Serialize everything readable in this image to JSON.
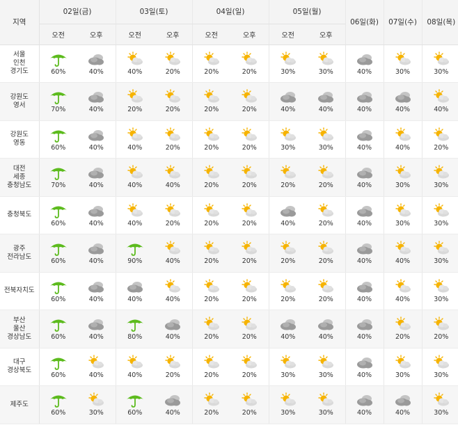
{
  "header": {
    "region_label": "지역",
    "days": [
      {
        "label": "02일(금)",
        "split": true
      },
      {
        "label": "03일(토)",
        "split": true
      },
      {
        "label": "04일(일)",
        "split": true
      },
      {
        "label": "05일(월)",
        "split": true
      },
      {
        "label": "06일(화)",
        "split": false
      },
      {
        "label": "07일(수)",
        "split": false
      },
      {
        "label": "08일(목)",
        "split": false
      }
    ],
    "am_label": "오전",
    "pm_label": "오후"
  },
  "legend_icons": {
    "rain": "umbrella-icon",
    "cloud": "cloud-icon",
    "partly": "partly-cloudy-icon"
  },
  "colors": {
    "umbrella": "#5dbb1e",
    "cloud": "#9a9a9a",
    "sun": "#f6b300"
  },
  "rows": [
    {
      "region": "서울\n인천\n경기도",
      "cells": [
        [
          "rain",
          "60%"
        ],
        [
          "cloud",
          "40%"
        ],
        [
          "partly",
          "40%"
        ],
        [
          "partly",
          "20%"
        ],
        [
          "partly",
          "20%"
        ],
        [
          "partly",
          "20%"
        ],
        [
          "partly",
          "30%"
        ],
        [
          "partly",
          "30%"
        ],
        [
          "cloud",
          "40%"
        ],
        [
          "partly",
          "30%"
        ],
        [
          "partly",
          "30%"
        ]
      ]
    },
    {
      "region": "강원도\n영서",
      "cells": [
        [
          "rain",
          "70%"
        ],
        [
          "cloud",
          "40%"
        ],
        [
          "partly",
          "20%"
        ],
        [
          "partly",
          "20%"
        ],
        [
          "partly",
          "20%"
        ],
        [
          "partly",
          "20%"
        ],
        [
          "cloud",
          "40%"
        ],
        [
          "cloud",
          "40%"
        ],
        [
          "cloud",
          "40%"
        ],
        [
          "cloud",
          "40%"
        ],
        [
          "partly",
          "40%"
        ]
      ]
    },
    {
      "region": "강원도\n영동",
      "cells": [
        [
          "rain",
          "60%"
        ],
        [
          "cloud",
          "40%"
        ],
        [
          "partly",
          "40%"
        ],
        [
          "partly",
          "20%"
        ],
        [
          "partly",
          "20%"
        ],
        [
          "partly",
          "20%"
        ],
        [
          "partly",
          "30%"
        ],
        [
          "partly",
          "30%"
        ],
        [
          "cloud",
          "40%"
        ],
        [
          "partly",
          "40%"
        ],
        [
          "partly",
          "20%"
        ]
      ]
    },
    {
      "region": "대전\n세종\n충청남도",
      "cells": [
        [
          "rain",
          "70%"
        ],
        [
          "cloud",
          "40%"
        ],
        [
          "partly",
          "40%"
        ],
        [
          "partly",
          "40%"
        ],
        [
          "partly",
          "20%"
        ],
        [
          "partly",
          "20%"
        ],
        [
          "partly",
          "20%"
        ],
        [
          "partly",
          "20%"
        ],
        [
          "cloud",
          "40%"
        ],
        [
          "partly",
          "30%"
        ],
        [
          "partly",
          "30%"
        ]
      ]
    },
    {
      "region": "충청북도",
      "cells": [
        [
          "rain",
          "60%"
        ],
        [
          "cloud",
          "40%"
        ],
        [
          "partly",
          "40%"
        ],
        [
          "partly",
          "20%"
        ],
        [
          "partly",
          "20%"
        ],
        [
          "partly",
          "20%"
        ],
        [
          "cloud",
          "40%"
        ],
        [
          "partly",
          "20%"
        ],
        [
          "cloud",
          "40%"
        ],
        [
          "partly",
          "30%"
        ],
        [
          "partly",
          "30%"
        ]
      ]
    },
    {
      "region": "광주\n전라남도",
      "cells": [
        [
          "rain",
          "60%"
        ],
        [
          "cloud",
          "40%"
        ],
        [
          "rain",
          "90%"
        ],
        [
          "partly",
          "40%"
        ],
        [
          "partly",
          "20%"
        ],
        [
          "partly",
          "20%"
        ],
        [
          "partly",
          "20%"
        ],
        [
          "partly",
          "20%"
        ],
        [
          "cloud",
          "40%"
        ],
        [
          "partly",
          "40%"
        ],
        [
          "partly",
          "30%"
        ]
      ]
    },
    {
      "region": "전북자치도",
      "cells": [
        [
          "rain",
          "60%"
        ],
        [
          "cloud",
          "40%"
        ],
        [
          "cloud",
          "40%"
        ],
        [
          "partly",
          "40%"
        ],
        [
          "partly",
          "20%"
        ],
        [
          "partly",
          "20%"
        ],
        [
          "partly",
          "20%"
        ],
        [
          "partly",
          "20%"
        ],
        [
          "cloud",
          "40%"
        ],
        [
          "partly",
          "40%"
        ],
        [
          "partly",
          "30%"
        ]
      ]
    },
    {
      "region": "부산\n울산\n경상남도",
      "cells": [
        [
          "rain",
          "60%"
        ],
        [
          "cloud",
          "40%"
        ],
        [
          "rain",
          "80%"
        ],
        [
          "cloud",
          "40%"
        ],
        [
          "partly",
          "20%"
        ],
        [
          "partly",
          "20%"
        ],
        [
          "cloud",
          "40%"
        ],
        [
          "cloud",
          "40%"
        ],
        [
          "cloud",
          "40%"
        ],
        [
          "partly",
          "20%"
        ],
        [
          "partly",
          "20%"
        ]
      ]
    },
    {
      "region": "대구\n경상북도",
      "cells": [
        [
          "rain",
          "60%"
        ],
        [
          "partly",
          "40%"
        ],
        [
          "partly",
          "40%"
        ],
        [
          "partly",
          "20%"
        ],
        [
          "partly",
          "20%"
        ],
        [
          "partly",
          "20%"
        ],
        [
          "partly",
          "30%"
        ],
        [
          "partly",
          "30%"
        ],
        [
          "cloud",
          "40%"
        ],
        [
          "partly",
          "30%"
        ],
        [
          "partly",
          "30%"
        ]
      ]
    },
    {
      "region": "제주도",
      "cells": [
        [
          "rain",
          "60%"
        ],
        [
          "partly",
          "30%"
        ],
        [
          "rain",
          "60%"
        ],
        [
          "cloud",
          "40%"
        ],
        [
          "partly",
          "20%"
        ],
        [
          "partly",
          "20%"
        ],
        [
          "partly",
          "30%"
        ],
        [
          "partly",
          "30%"
        ],
        [
          "cloud",
          "40%"
        ],
        [
          "cloud",
          "40%"
        ],
        [
          "partly",
          "30%"
        ]
      ]
    }
  ]
}
